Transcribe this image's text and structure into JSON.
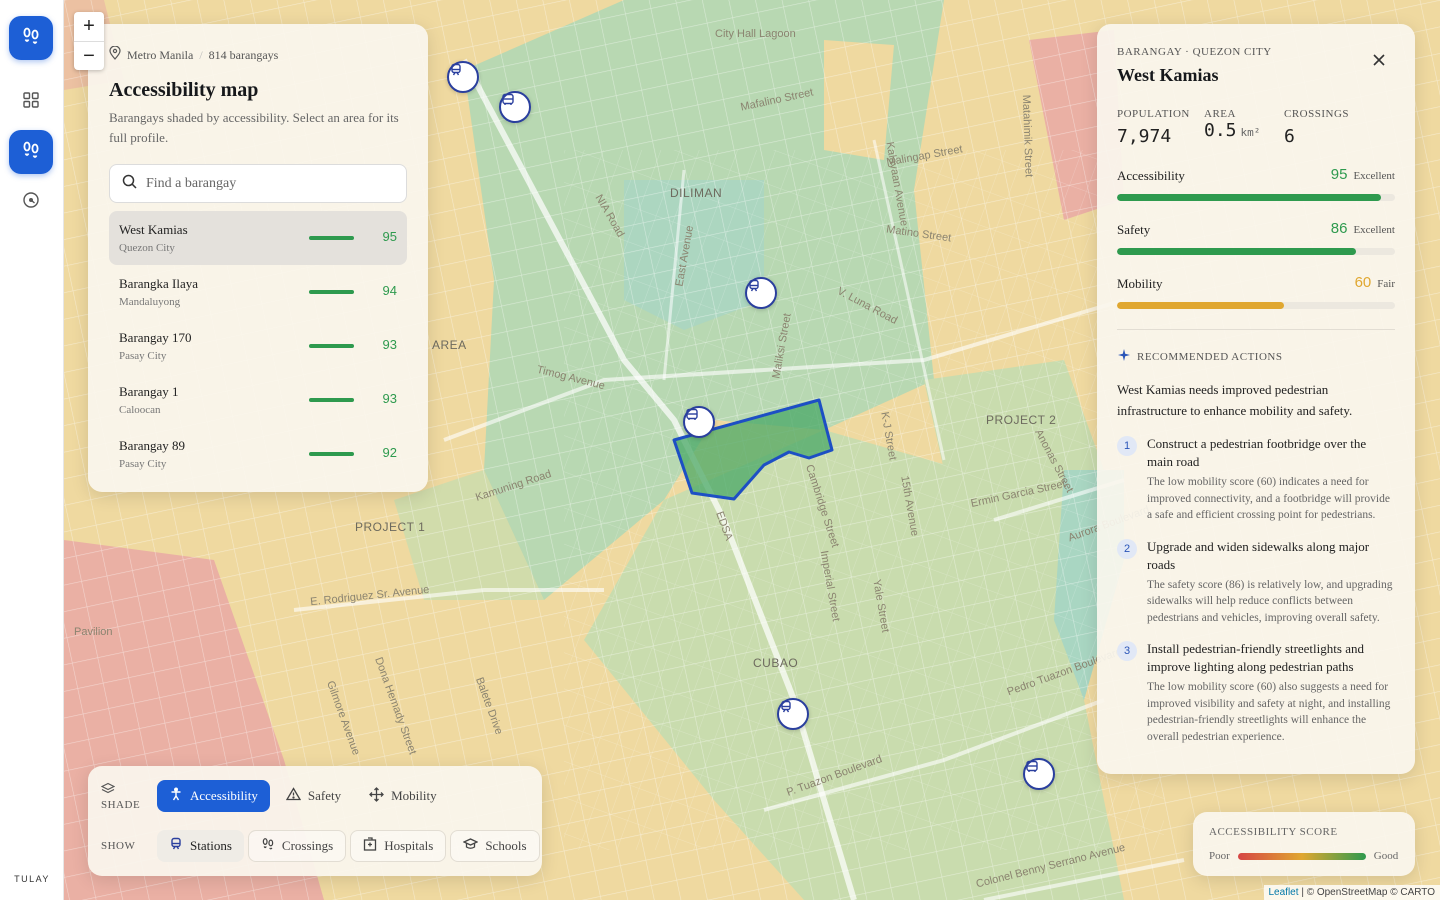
{
  "app": {
    "brand": "TULAY"
  },
  "rail": {
    "items": [
      "footsteps-icon",
      "grid-icon",
      "footsteps-icon",
      "gauge-icon"
    ]
  },
  "zoom": {
    "in": "+",
    "out": "−"
  },
  "map": {
    "street_labels": [
      "City Hall Lagoon",
      "Mafalino Street",
      "Malingap Street",
      "Matino Street",
      "V. Luna Road",
      "Timog Avenue",
      "Kamuning Road",
      "E. Rodriguez Sr. Avenue",
      "Pavilion",
      "EDSA",
      "East Avenue",
      "NIA Road",
      "Maliksi Street",
      "Kalayaan Avenue",
      "K-J Street",
      "Ermin Garcia Street",
      "Aurora Boulevard",
      "Pedro Tuazon Boulevard",
      "Colonel Benny Serrano Avenue",
      "P. Tuazon Boulevard",
      "Dona Hemady Street",
      "Gilmore Avenue",
      "Balete Drive",
      "Yale Street",
      "Cambridge Street",
      "Imperial Street",
      "15th Avenue",
      "Anonas Street",
      "Matahimik Street"
    ],
    "area_labels": [
      "DILIMAN",
      "AREA",
      "PROJECT 2",
      "PROJECT 1",
      "CUBAO"
    ]
  },
  "left_panel": {
    "crumb_region": "Metro Manila",
    "crumb_count": "814 barangays",
    "title": "Accessibility map",
    "subtitle": "Barangays shaded by accessibility. Select an area for its full profile.",
    "search_placeholder": "Find a barangay",
    "list": [
      {
        "name": "West Kamias",
        "city": "Quezon City",
        "score": "95"
      },
      {
        "name": "Barangka Ilaya",
        "city": "Mandaluyong",
        "score": "94"
      },
      {
        "name": "Barangay 170",
        "city": "Pasay City",
        "score": "93"
      },
      {
        "name": "Barangay 1",
        "city": "Caloocan",
        "score": "93"
      },
      {
        "name": "Barangay 89",
        "city": "Pasay City",
        "score": "92"
      }
    ]
  },
  "right_panel": {
    "kicker": "BARANGAY · QUEZON CITY",
    "title": "West Kamias",
    "stats": {
      "population_label": "POPULATION",
      "population": "7,974",
      "area_label": "AREA",
      "area": "0.5",
      "area_unit": "km²",
      "crossings_label": "CROSSINGS",
      "crossings": "6"
    },
    "metrics": [
      {
        "label": "Accessibility",
        "score": "95",
        "rating": "Excellent",
        "fraction": 0.95,
        "color": "#2e9a4e"
      },
      {
        "label": "Safety",
        "score": "86",
        "rating": "Excellent",
        "fraction": 0.86,
        "color": "#2e9a4e"
      },
      {
        "label": "Mobility",
        "score": "60",
        "rating": "Fair",
        "fraction": 0.6,
        "color": "#e0a730"
      }
    ],
    "rec_heading": "RECOMMENDED ACTIONS",
    "rec_intro": "West Kamias needs improved pedestrian infrastructure to enhance mobility and safety.",
    "recs": [
      {
        "n": "1",
        "title": "Construct a pedestrian footbridge over the main road",
        "desc": "The low mobility score (60) indicates a need for improved connectivity, and a footbridge will provide a safe and efficient crossing point for pedestrians."
      },
      {
        "n": "2",
        "title": "Upgrade and widen sidewalks along major roads",
        "desc": "The safety score (86) is relatively low, and upgrading sidewalks will help reduce conflicts between pedestrians and vehicles, improving overall safety."
      },
      {
        "n": "3",
        "title": "Install pedestrian-friendly streetlights and improve lighting along pedestrian paths",
        "desc": "The low mobility score (60) also suggests a need for improved visibility and safety at night, and installing pedestrian-friendly streetlights will enhance the overall pedestrian experience."
      }
    ]
  },
  "controls": {
    "shade_label": "SHADE",
    "shade_options": [
      "Accessibility",
      "Safety",
      "Mobility"
    ],
    "shade_selected": "Accessibility",
    "show_label": "SHOW",
    "show_options": [
      "Stations",
      "Crossings",
      "Hospitals",
      "Schools"
    ],
    "show_active": "Stations"
  },
  "legend": {
    "title": "ACCESSIBILITY SCORE",
    "low": "Poor",
    "high": "Good"
  },
  "attribution": {
    "leaflet": "Leaflet",
    "rest": "| © OpenStreetMap © CARTO"
  },
  "colors": {
    "accent": "#1d5fd6",
    "good": "#2e9a4e",
    "fair": "#e0a730",
    "poor": "#d64545",
    "selection": "#1d4fc4"
  }
}
